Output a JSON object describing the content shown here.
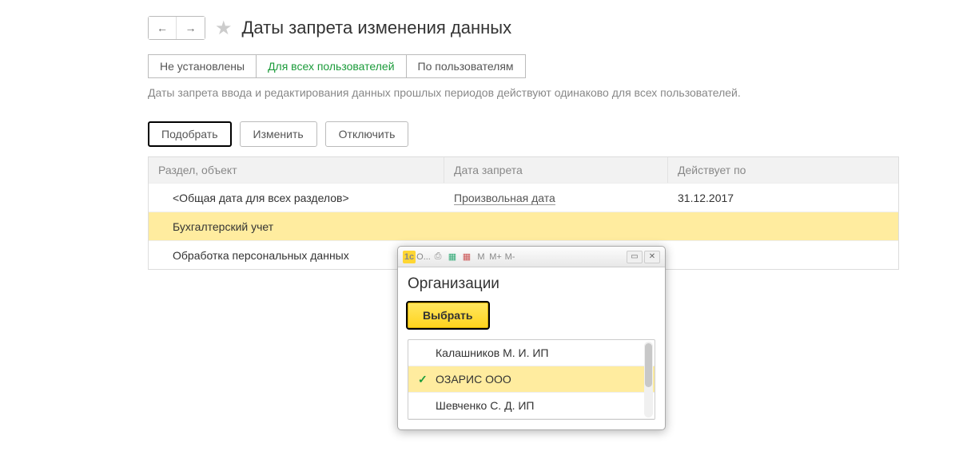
{
  "header": {
    "title": "Даты запрета изменения данных"
  },
  "tabs": {
    "not_set": "Не установлены",
    "all_users": "Для всех пользователей",
    "by_users": "По пользователям"
  },
  "description": "Даты запрета ввода и редактирования данных прошлых периодов действуют одинаково для всех пользователей.",
  "actions": {
    "pick": "Подобрать",
    "edit": "Изменить",
    "disable": "Отключить"
  },
  "table": {
    "headers": {
      "section": "Раздел, объект",
      "ban_date": "Дата запрета",
      "valid_to": "Действует по"
    },
    "rows": {
      "r0_section": "<Общая дата для всех разделов>",
      "r0_bandate": "Произвольная дата",
      "r0_validto": "31.12.2017",
      "r1_section": "Бухгалтерский учет",
      "r2_section": "Обработка персональных данных"
    }
  },
  "dialog": {
    "titlebar_text": "О...",
    "tb_m": "M",
    "tb_mplus": "M+",
    "tb_mminus": "M-",
    "title": "Организации",
    "select_label": "Выбрать",
    "orgs": {
      "o0": "Калашников М. И. ИП",
      "o1": "ОЗАРИС ООО",
      "o2": "Шевченко С. Д. ИП"
    }
  }
}
